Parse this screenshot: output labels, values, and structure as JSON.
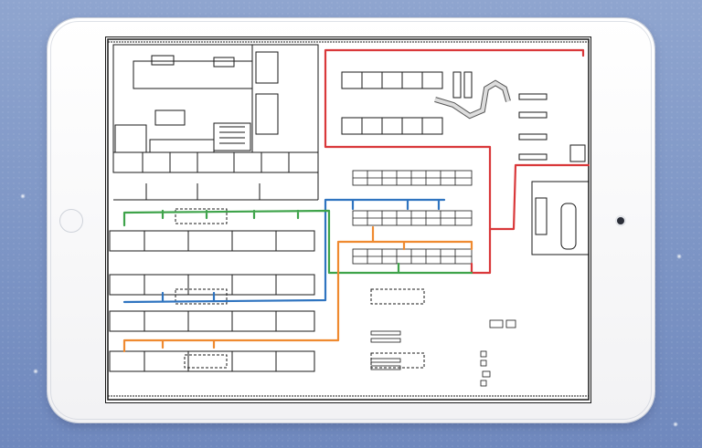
{
  "app": {
    "device": "tablet",
    "content": "warehouse-floor-plan"
  },
  "routes": [
    {
      "name_key": "red-route",
      "color": "#d9383a"
    },
    {
      "name_key": "blue-route",
      "color": "#2f74c0"
    },
    {
      "name_key": "green-route",
      "color": "#3ea34a"
    },
    {
      "name_key": "orange-route",
      "color": "#ef8a30"
    }
  ],
  "colors": {
    "background": "#7f97c8",
    "tablet_frame": "#ffffff",
    "plan_line": "#1a1a1a"
  }
}
